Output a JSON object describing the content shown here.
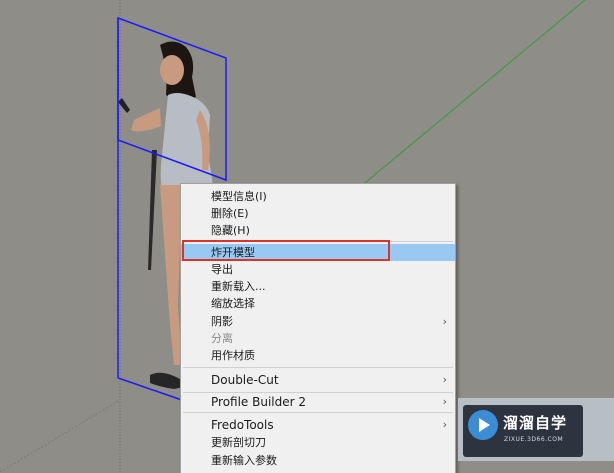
{
  "menu": {
    "items": [
      {
        "label": "模型信息(I)",
        "disabled": false,
        "submenu": false
      },
      {
        "label": "删除(E)",
        "disabled": false,
        "submenu": false
      },
      {
        "label": "隐藏(H)",
        "disabled": false,
        "submenu": false
      },
      {
        "label": "炸开模型",
        "disabled": false,
        "submenu": false,
        "highlighted": true
      },
      {
        "label": "导出",
        "disabled": false,
        "submenu": false
      },
      {
        "label": "重新载入...",
        "disabled": false,
        "submenu": false
      },
      {
        "label": "缩放选择",
        "disabled": false,
        "submenu": false
      },
      {
        "label": "阴影",
        "disabled": false,
        "submenu": true
      },
      {
        "label": "分离",
        "disabled": true,
        "submenu": false
      },
      {
        "label": "用作材质",
        "disabled": false,
        "submenu": false
      },
      {
        "label": "Double-Cut",
        "disabled": false,
        "submenu": true
      },
      {
        "label": "Profile Builder 2",
        "disabled": false,
        "submenu": true
      },
      {
        "label": "FredoTools",
        "disabled": false,
        "submenu": true
      },
      {
        "label": "更新剖切刀",
        "disabled": false,
        "submenu": false
      },
      {
        "label": "重新输入参数",
        "disabled": false,
        "submenu": false
      }
    ],
    "submenu_arrow": "›"
  },
  "watermark": {
    "title": "溜溜自学",
    "subtitle": "ZIXUE.3D66.COM",
    "icon": "play-icon"
  },
  "colors": {
    "viewport_bg": "#8e8d87",
    "selection_box": "#1a1aff",
    "green_axis": "#39a839",
    "highlight": "#99c9f3",
    "callout": "#d9332a"
  }
}
